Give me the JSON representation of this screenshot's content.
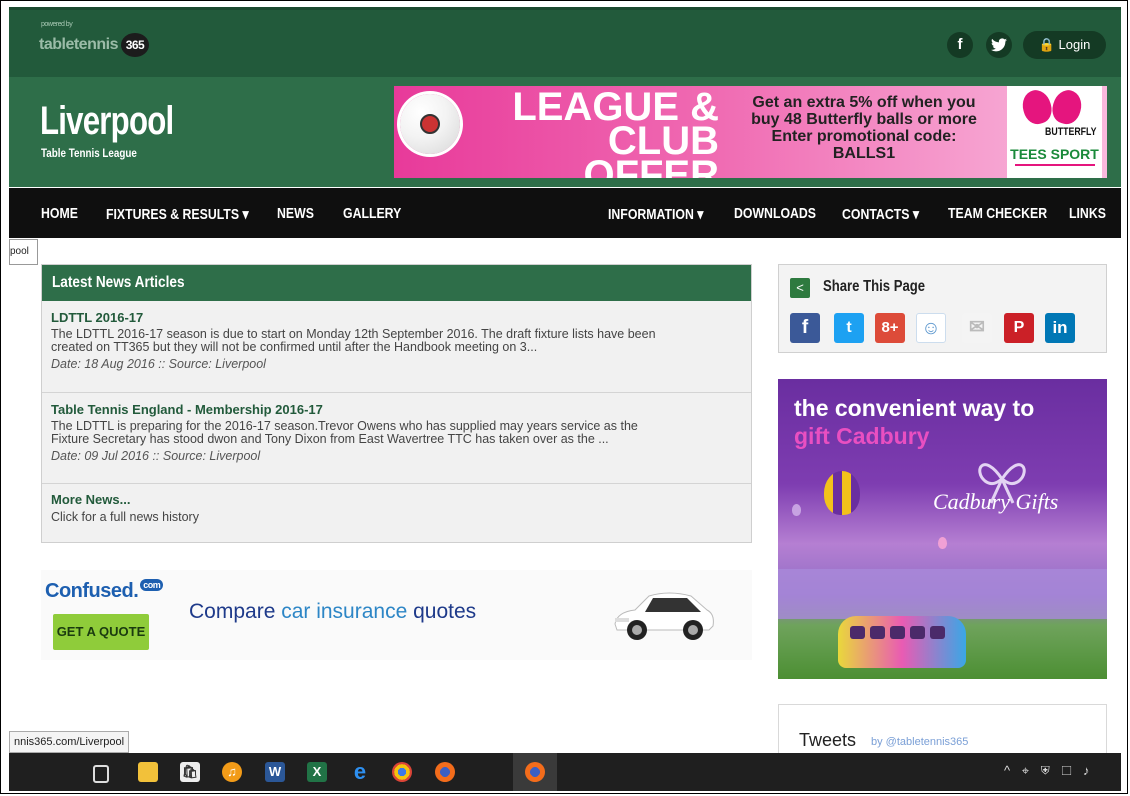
{
  "brand": {
    "small": "tabletennis",
    "badge": "365",
    "powered": "powered by"
  },
  "social": {
    "facebook_glyph": "f",
    "twitter_glyph": "♥",
    "login_icon": "🔒",
    "login": "Login"
  },
  "site": {
    "title": "Liverpool",
    "subtitle": "Table Tennis League"
  },
  "banner": {
    "big_line1": "LEAGUE &",
    "big_line2": "CLUB OFFER",
    "mid_line1": "Get an extra 5% off when you",
    "mid_line2": "buy 48 Butterfly balls or more",
    "mid_line3": "Enter promotional code:",
    "mid_line4": "BALLS1",
    "brand": "BUTTERFLY",
    "tees": "TEES SPORT"
  },
  "nav": {
    "items": [
      "HOME",
      "FIXTURES & RESULTS ▾",
      "NEWS",
      "GALLERY",
      "INFORMATION ▾",
      "DOWNLOADS",
      "CONTACTS ▾",
      "TEAM CHECKER",
      "LINKS"
    ]
  },
  "tooltip": "pool",
  "news": {
    "heading": "Latest News Articles",
    "articles": [
      {
        "title": "LDTTL 2016-17",
        "body1": "The LDTTL 2016-17 season is due to start on Monday 12th September 2016.  The draft fixture lists have been",
        "body2": "created on TT365 but they will not be confirmed until after the Handbook meeting on 3...",
        "meta": "Date: 18 Aug 2016 :: Source: Liverpool"
      },
      {
        "title": "Table Tennis England - Membership 2016-17",
        "body1": "The LDTTL is preparing for the 2016-17 season.Trevor Owens who has supplied may years service as the",
        "body2": "Fixture Secretary has stood dwon and Tony Dixon from East Wavertree TTC has taken over as the ...",
        "meta": "Date: 09 Jul 2016 :: Source: Liverpool"
      }
    ],
    "more_title": "More News...",
    "more_body": "Click for a full news history"
  },
  "ad": {
    "brand": "Confused.",
    "brand_com": "com",
    "button": "GET A QUOTE",
    "text_a": "Compare ",
    "text_b": "car insurance",
    "text_c": " quotes"
  },
  "share": {
    "title": "Share This Page",
    "icons": [
      "f",
      "t",
      "8+",
      "☺",
      "✉",
      "P",
      "in"
    ]
  },
  "cadbury": {
    "line1": "the convenient way to",
    "line2": "gift Cadbury",
    "brand": "Cadbury Gifts"
  },
  "tweets": {
    "title": "Tweets",
    "by": "by @tabletennis365"
  },
  "status_url": "nnis365.com/Liverpool",
  "taskbar": {
    "tray": "^ ⌖ ⛨ ☐ ♪"
  }
}
